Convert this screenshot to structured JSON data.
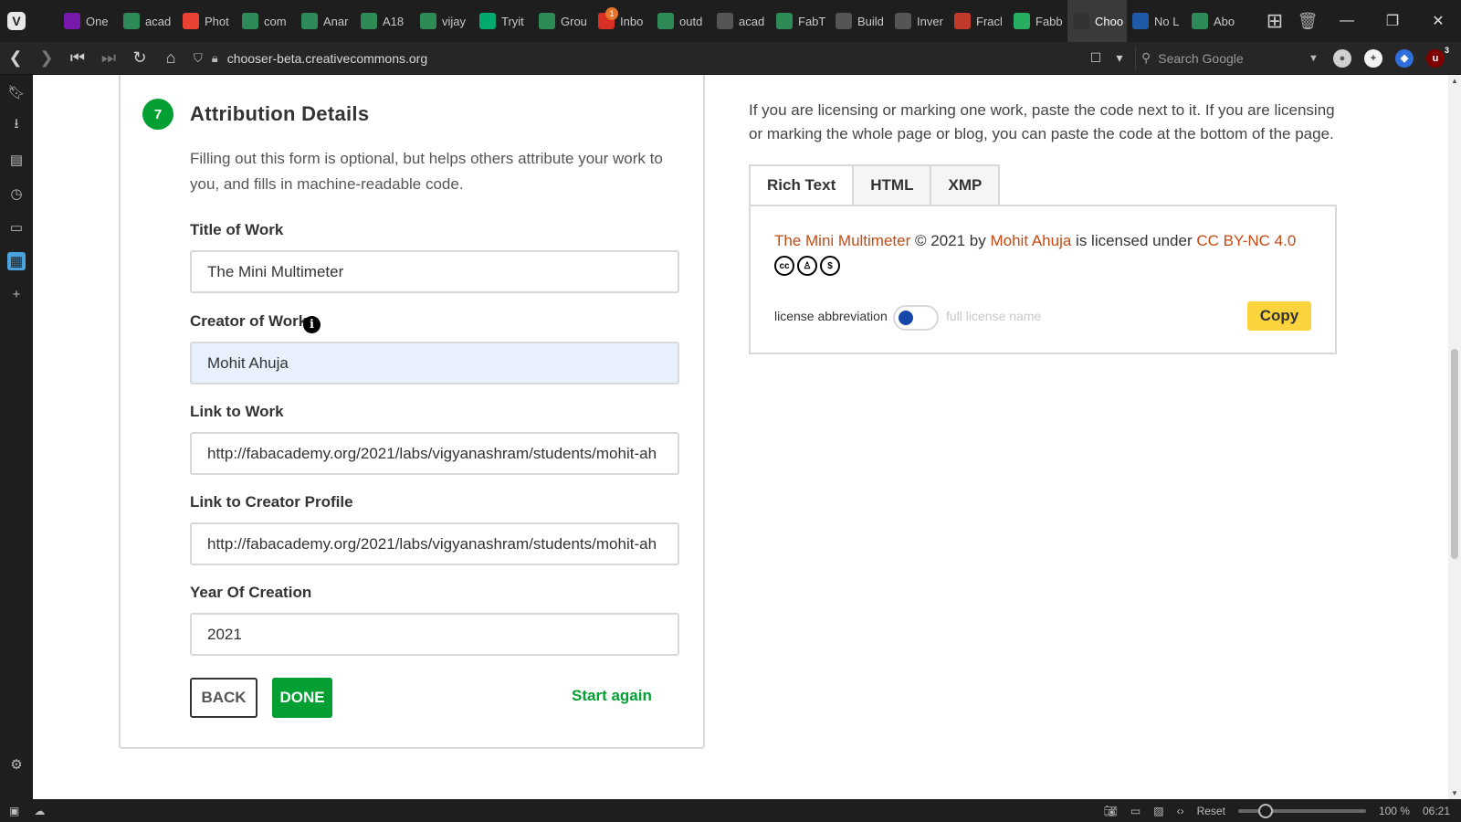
{
  "browser": {
    "tabs": [
      {
        "label": "One",
        "icon": "onenote-icon",
        "color": "#7719aa"
      },
      {
        "label": "acad",
        "icon": "fabacademy-icon",
        "color": "#2e8b57"
      },
      {
        "label": "Phot",
        "icon": "photos-icon",
        "color": "#ea4335"
      },
      {
        "label": "com",
        "icon": "fabacademy-icon",
        "color": "#2e8b57"
      },
      {
        "label": "Anar",
        "icon": "fabacademy-icon",
        "color": "#2e8b57"
      },
      {
        "label": "A18",
        "icon": "fabacademy-icon",
        "color": "#2e8b57"
      },
      {
        "label": "vijay",
        "icon": "fabacademy-icon",
        "color": "#2e8b57"
      },
      {
        "label": "Tryit",
        "icon": "w3schools-icon",
        "color": "#04aa6d"
      },
      {
        "label": "Grou",
        "icon": "fabacademy-icon",
        "color": "#2e8b57"
      },
      {
        "label": "Inbo",
        "icon": "gmail-icon",
        "color": "#d93025",
        "badge": "1"
      },
      {
        "label": "outd",
        "icon": "fabacademy-icon",
        "color": "#2e8b57"
      },
      {
        "label": "acad",
        "icon": "document-icon",
        "color": "#555555"
      },
      {
        "label": "FabT",
        "icon": "fabacademy-icon",
        "color": "#2e8b57"
      },
      {
        "label": "Build",
        "icon": "document-icon",
        "color": "#555555"
      },
      {
        "label": "Inver",
        "icon": "book-icon",
        "color": "#555555"
      },
      {
        "label": "Fracl",
        "icon": "fracktal-icon",
        "color": "#c0392b"
      },
      {
        "label": "Fabb",
        "icon": "fabbrix-icon",
        "color": "#27ae60"
      },
      {
        "label": "Choo",
        "icon": "cc-icon",
        "color": "#333333",
        "active": true
      },
      {
        "label": "No L",
        "icon": "question-icon",
        "color": "#1e5aa8"
      },
      {
        "label": "Abo",
        "icon": "fabacademy-icon",
        "color": "#2e8b57"
      }
    ],
    "url": "chooser-beta.creativecommons.org",
    "search_placeholder": "Search Google",
    "ext_badge": "3",
    "zoom_reset": "Reset",
    "zoom_level": "100 %",
    "clock": "06:21"
  },
  "step": {
    "number": "7",
    "title": "Attribution Details",
    "description": "Filling out this form is optional, but helps others attribute your work to you, and fills in machine-readable code."
  },
  "form": {
    "title_label": "Title of Work",
    "title_value": "The Mini Multimeter",
    "creator_label": "Creator of Work",
    "creator_value": "Mohit Ahuja",
    "link_work_label": "Link to Work",
    "link_work_value": "http://fabacademy.org/2021/labs/vigyanashram/students/mohit-ah",
    "link_creator_label": "Link to Creator Profile",
    "link_creator_value": "http://fabacademy.org/2021/labs/vigyanashram/students/mohit-ah",
    "year_label": "Year Of Creation",
    "year_value": "2021",
    "back_label": "BACK",
    "done_label": "DONE",
    "start_again_label": "Start again"
  },
  "right": {
    "description": "If you are licensing or marking one work, paste the code next to it. If you are licensing or marking the whole page or blog, you can paste the code at the bottom of the page.",
    "tabs": [
      "Rich Text",
      "HTML",
      "XMP"
    ],
    "attribution": {
      "work": "The Mini Multimeter",
      "mid1": " © 2021 by ",
      "creator": "Mohit Ahuja",
      "mid2": " is licensed under ",
      "license": "CC BY-NC 4.0"
    },
    "cc_icons": [
      "cc",
      "by",
      "nc"
    ],
    "toggle_left": "license abbreviation",
    "toggle_right": "full license name",
    "copy_label": "Copy"
  },
  "colors": {
    "accent_green": "#049f32",
    "link_orange": "#c54a13",
    "copy_yellow": "#fbd43d",
    "toggle_blue": "#1547a8"
  }
}
